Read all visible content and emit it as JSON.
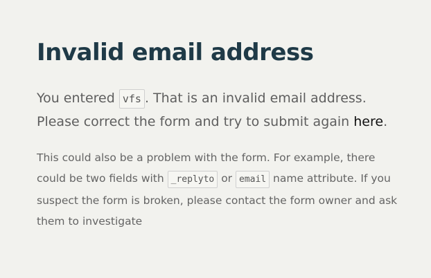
{
  "heading": "Invalid email address",
  "lead": {
    "prefix": "You entered ",
    "entered_value": "vfs",
    "middle": ". That is an invalid email address. Please correct the form and try to submit again ",
    "link_text": "here",
    "suffix": "."
  },
  "sub": {
    "part1": "This could also be a problem with the form. For example, there could be two fields with ",
    "code1": "_replyto",
    "part2": " or ",
    "code2": "email",
    "part3": " name attribute. If you suspect the form is broken, please contact the form owner and ask them to investigate"
  },
  "colors": {
    "background": "#f2f2ee",
    "heading": "#1f3a47",
    "text": "#5e5e5e",
    "link": "#111111"
  }
}
